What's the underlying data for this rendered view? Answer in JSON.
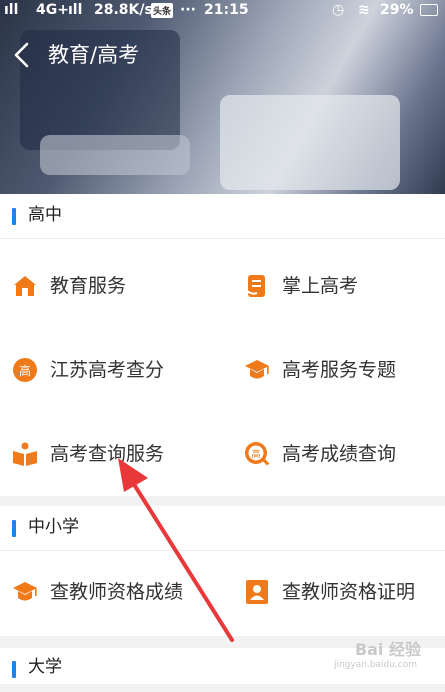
{
  "status_bar": {
    "signal_left": "4G+",
    "speed": "28.8K/s",
    "app_pill": "头条",
    "dots": "···",
    "time": "21:15",
    "battery": "29%"
  },
  "nav": {
    "title": "教育/高考"
  },
  "sections": [
    {
      "title": "高中",
      "rows": [
        [
          {
            "label": "教育服务",
            "icon": "house-icon"
          },
          {
            "label": "掌上高考",
            "icon": "phone-book-icon"
          }
        ],
        [
          {
            "label": "江苏高考查分",
            "icon": "gao-badge-icon"
          },
          {
            "label": "高考服务专题",
            "icon": "graduation-cap-icon"
          }
        ],
        [
          {
            "label": "高考查询服务",
            "icon": "open-book-icon"
          },
          {
            "label": "高考成绩查询",
            "icon": "gao-search-icon"
          }
        ]
      ]
    },
    {
      "title": "中小学",
      "rows": [
        [
          {
            "label": "查教师资格成绩",
            "icon": "graduation-cap-icon"
          },
          {
            "label": "查教师资格证明",
            "icon": "id-card-icon"
          }
        ]
      ]
    },
    {
      "title": "大学",
      "rows": []
    }
  ],
  "icon_glyph": {
    "gao": "高"
  },
  "watermark": {
    "brand": "Bai 经验",
    "sub": "jingyan.baidu.com"
  },
  "colors": {
    "accent": "#1e84e8",
    "icon_orange": "#f07a1a",
    "annotation_arrow": "#e8383a"
  }
}
